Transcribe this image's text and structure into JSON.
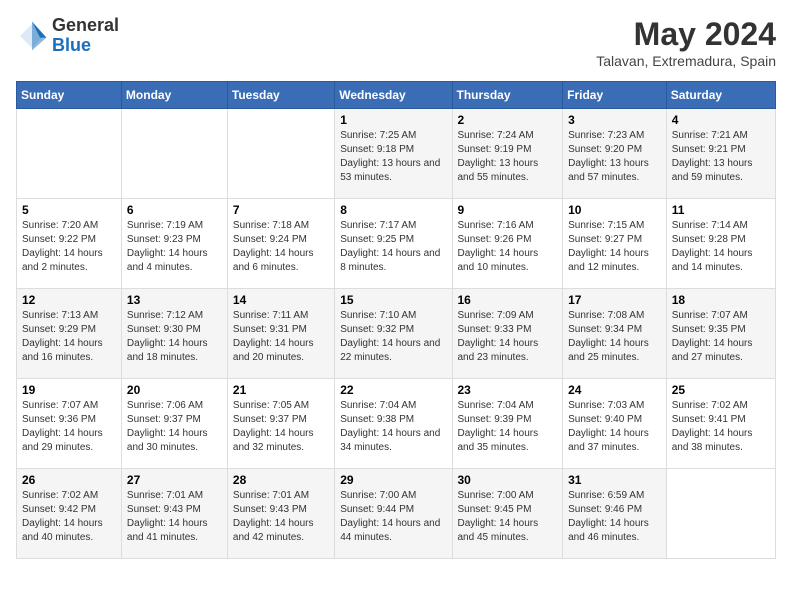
{
  "header": {
    "logo": {
      "general": "General",
      "blue": "Blue"
    },
    "title": "May 2024",
    "location": "Talavan, Extremadura, Spain"
  },
  "days_of_week": [
    "Sunday",
    "Monday",
    "Tuesday",
    "Wednesday",
    "Thursday",
    "Friday",
    "Saturday"
  ],
  "weeks": [
    [
      {
        "day": "",
        "sunrise": "",
        "sunset": "",
        "daylight": ""
      },
      {
        "day": "",
        "sunrise": "",
        "sunset": "",
        "daylight": ""
      },
      {
        "day": "",
        "sunrise": "",
        "sunset": "",
        "daylight": ""
      },
      {
        "day": "1",
        "sunrise": "Sunrise: 7:25 AM",
        "sunset": "Sunset: 9:18 PM",
        "daylight": "Daylight: 13 hours and 53 minutes."
      },
      {
        "day": "2",
        "sunrise": "Sunrise: 7:24 AM",
        "sunset": "Sunset: 9:19 PM",
        "daylight": "Daylight: 13 hours and 55 minutes."
      },
      {
        "day": "3",
        "sunrise": "Sunrise: 7:23 AM",
        "sunset": "Sunset: 9:20 PM",
        "daylight": "Daylight: 13 hours and 57 minutes."
      },
      {
        "day": "4",
        "sunrise": "Sunrise: 7:21 AM",
        "sunset": "Sunset: 9:21 PM",
        "daylight": "Daylight: 13 hours and 59 minutes."
      }
    ],
    [
      {
        "day": "5",
        "sunrise": "Sunrise: 7:20 AM",
        "sunset": "Sunset: 9:22 PM",
        "daylight": "Daylight: 14 hours and 2 minutes."
      },
      {
        "day": "6",
        "sunrise": "Sunrise: 7:19 AM",
        "sunset": "Sunset: 9:23 PM",
        "daylight": "Daylight: 14 hours and 4 minutes."
      },
      {
        "day": "7",
        "sunrise": "Sunrise: 7:18 AM",
        "sunset": "Sunset: 9:24 PM",
        "daylight": "Daylight: 14 hours and 6 minutes."
      },
      {
        "day": "8",
        "sunrise": "Sunrise: 7:17 AM",
        "sunset": "Sunset: 9:25 PM",
        "daylight": "Daylight: 14 hours and 8 minutes."
      },
      {
        "day": "9",
        "sunrise": "Sunrise: 7:16 AM",
        "sunset": "Sunset: 9:26 PM",
        "daylight": "Daylight: 14 hours and 10 minutes."
      },
      {
        "day": "10",
        "sunrise": "Sunrise: 7:15 AM",
        "sunset": "Sunset: 9:27 PM",
        "daylight": "Daylight: 14 hours and 12 minutes."
      },
      {
        "day": "11",
        "sunrise": "Sunrise: 7:14 AM",
        "sunset": "Sunset: 9:28 PM",
        "daylight": "Daylight: 14 hours and 14 minutes."
      }
    ],
    [
      {
        "day": "12",
        "sunrise": "Sunrise: 7:13 AM",
        "sunset": "Sunset: 9:29 PM",
        "daylight": "Daylight: 14 hours and 16 minutes."
      },
      {
        "day": "13",
        "sunrise": "Sunrise: 7:12 AM",
        "sunset": "Sunset: 9:30 PM",
        "daylight": "Daylight: 14 hours and 18 minutes."
      },
      {
        "day": "14",
        "sunrise": "Sunrise: 7:11 AM",
        "sunset": "Sunset: 9:31 PM",
        "daylight": "Daylight: 14 hours and 20 minutes."
      },
      {
        "day": "15",
        "sunrise": "Sunrise: 7:10 AM",
        "sunset": "Sunset: 9:32 PM",
        "daylight": "Daylight: 14 hours and 22 minutes."
      },
      {
        "day": "16",
        "sunrise": "Sunrise: 7:09 AM",
        "sunset": "Sunset: 9:33 PM",
        "daylight": "Daylight: 14 hours and 23 minutes."
      },
      {
        "day": "17",
        "sunrise": "Sunrise: 7:08 AM",
        "sunset": "Sunset: 9:34 PM",
        "daylight": "Daylight: 14 hours and 25 minutes."
      },
      {
        "day": "18",
        "sunrise": "Sunrise: 7:07 AM",
        "sunset": "Sunset: 9:35 PM",
        "daylight": "Daylight: 14 hours and 27 minutes."
      }
    ],
    [
      {
        "day": "19",
        "sunrise": "Sunrise: 7:07 AM",
        "sunset": "Sunset: 9:36 PM",
        "daylight": "Daylight: 14 hours and 29 minutes."
      },
      {
        "day": "20",
        "sunrise": "Sunrise: 7:06 AM",
        "sunset": "Sunset: 9:37 PM",
        "daylight": "Daylight: 14 hours and 30 minutes."
      },
      {
        "day": "21",
        "sunrise": "Sunrise: 7:05 AM",
        "sunset": "Sunset: 9:37 PM",
        "daylight": "Daylight: 14 hours and 32 minutes."
      },
      {
        "day": "22",
        "sunrise": "Sunrise: 7:04 AM",
        "sunset": "Sunset: 9:38 PM",
        "daylight": "Daylight: 14 hours and 34 minutes."
      },
      {
        "day": "23",
        "sunrise": "Sunrise: 7:04 AM",
        "sunset": "Sunset: 9:39 PM",
        "daylight": "Daylight: 14 hours and 35 minutes."
      },
      {
        "day": "24",
        "sunrise": "Sunrise: 7:03 AM",
        "sunset": "Sunset: 9:40 PM",
        "daylight": "Daylight: 14 hours and 37 minutes."
      },
      {
        "day": "25",
        "sunrise": "Sunrise: 7:02 AM",
        "sunset": "Sunset: 9:41 PM",
        "daylight": "Daylight: 14 hours and 38 minutes."
      }
    ],
    [
      {
        "day": "26",
        "sunrise": "Sunrise: 7:02 AM",
        "sunset": "Sunset: 9:42 PM",
        "daylight": "Daylight: 14 hours and 40 minutes."
      },
      {
        "day": "27",
        "sunrise": "Sunrise: 7:01 AM",
        "sunset": "Sunset: 9:43 PM",
        "daylight": "Daylight: 14 hours and 41 minutes."
      },
      {
        "day": "28",
        "sunrise": "Sunrise: 7:01 AM",
        "sunset": "Sunset: 9:43 PM",
        "daylight": "Daylight: 14 hours and 42 minutes."
      },
      {
        "day": "29",
        "sunrise": "Sunrise: 7:00 AM",
        "sunset": "Sunset: 9:44 PM",
        "daylight": "Daylight: 14 hours and 44 minutes."
      },
      {
        "day": "30",
        "sunrise": "Sunrise: 7:00 AM",
        "sunset": "Sunset: 9:45 PM",
        "daylight": "Daylight: 14 hours and 45 minutes."
      },
      {
        "day": "31",
        "sunrise": "Sunrise: 6:59 AM",
        "sunset": "Sunset: 9:46 PM",
        "daylight": "Daylight: 14 hours and 46 minutes."
      },
      {
        "day": "",
        "sunrise": "",
        "sunset": "",
        "daylight": ""
      }
    ]
  ]
}
